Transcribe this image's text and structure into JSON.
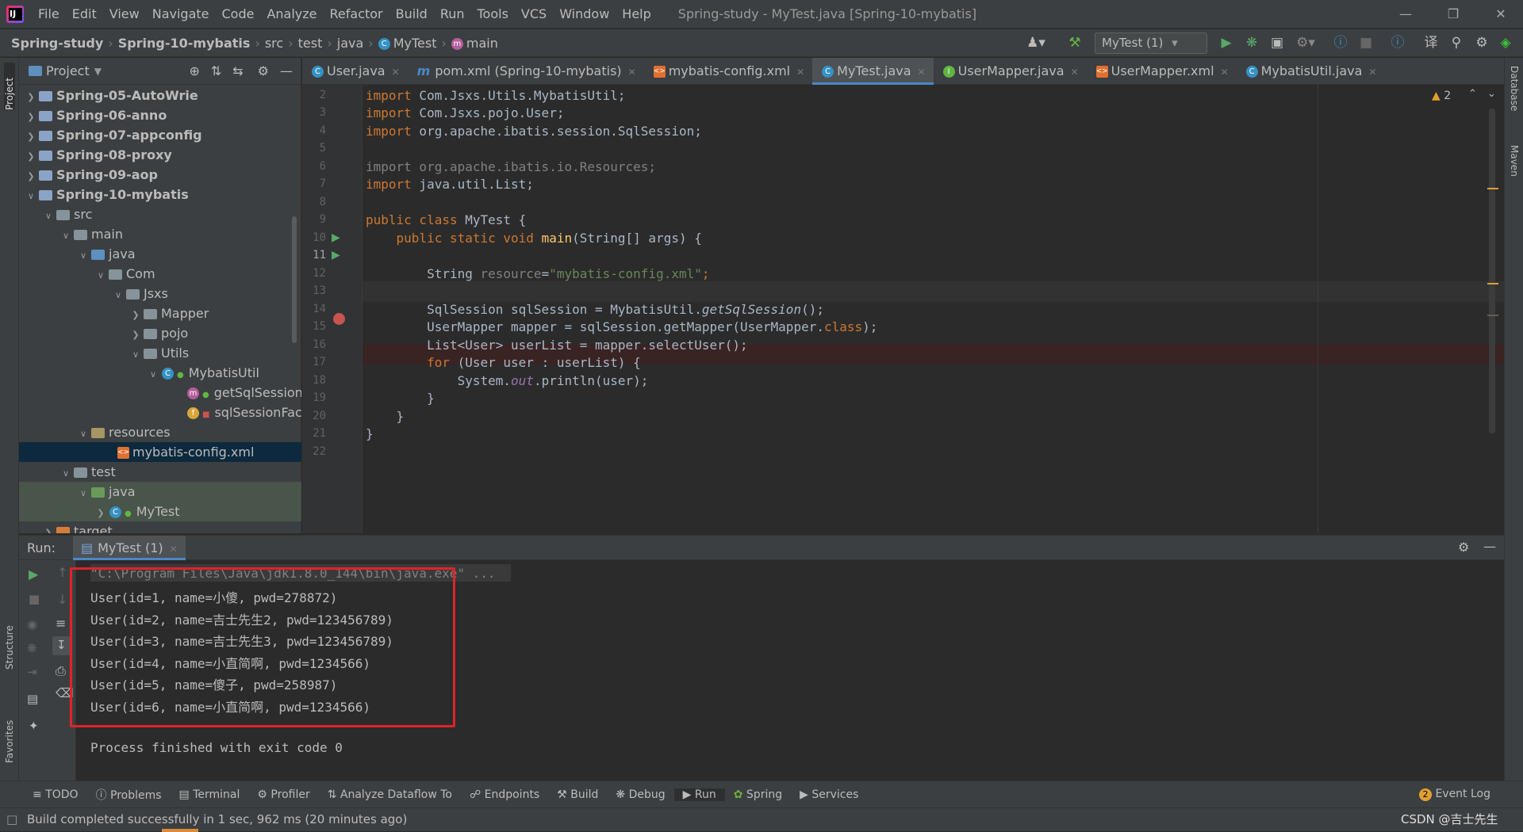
{
  "menu": [
    "File",
    "Edit",
    "View",
    "Navigate",
    "Code",
    "Analyze",
    "Refactor",
    "Build",
    "Run",
    "Tools",
    "VCS",
    "Window",
    "Help"
  ],
  "window_title": "Spring-study - MyTest.java [Spring-10-mybatis]",
  "breadcrumb": {
    "project": "Spring-study",
    "module": "Spring-10-mybatis",
    "src": "src",
    "test": "test",
    "java": "java",
    "class": "MyTest",
    "method": "main"
  },
  "run_config": "MyTest (1)",
  "project_panel": {
    "title": "Project"
  },
  "tree": [
    {
      "label": "Spring-05-AutoWrie",
      "bold": true
    },
    {
      "label": "Spring-06-anno",
      "bold": true
    },
    {
      "label": "Spring-07-appconfig",
      "bold": true
    },
    {
      "label": "Spring-08-proxy",
      "bold": true
    },
    {
      "label": "Spring-09-aop",
      "bold": true
    },
    {
      "label": "Spring-10-mybatis",
      "bold": true
    },
    {
      "label": "src"
    },
    {
      "label": "main"
    },
    {
      "label": "java"
    },
    {
      "label": "Com"
    },
    {
      "label": "Jsxs"
    },
    {
      "label": "Mapper"
    },
    {
      "label": "pojo"
    },
    {
      "label": "Utils"
    },
    {
      "label": "MybatisUtil"
    },
    {
      "label": "getSqlSession"
    },
    {
      "label": "sqlSessionFactory"
    },
    {
      "label": "resources"
    },
    {
      "label": "mybatis-config.xml"
    },
    {
      "label": "test"
    },
    {
      "label": "java"
    },
    {
      "label": "MyTest"
    },
    {
      "label": "target"
    }
  ],
  "tabs": [
    "User.java",
    "pom.xml (Spring-10-mybatis)",
    "mybatis-config.xml",
    "MyTest.java",
    "UserMapper.java",
    "UserMapper.xml",
    "MybatisUtil.java"
  ],
  "warnings": "2",
  "line_numbers": [
    "2",
    "3",
    "4",
    "5",
    "6",
    "7",
    "8",
    "9",
    "10",
    "11",
    "12",
    "13",
    "14",
    "15",
    "16",
    "17",
    "18",
    "19",
    "20",
    "21",
    "22"
  ],
  "code": {
    "l2a": "import",
    "l2b": " Com.Jsxs.Utils.MybatisUtil;",
    "l3a": "import",
    "l3b": " Com.Jsxs.pojo.User;",
    "l4a": "import",
    "l4b": " org.apache.ibatis.session.SqlSession;",
    "l6": "import org.apache.ibatis.io.Resources;",
    "l7a": "import",
    "l7b": " java.util.List;",
    "l9a": "public class",
    "l9b": " MyTest {",
    "l10a": "    public static void ",
    "l10b": "main",
    "l10c": "(String[] args) {",
    "l12a": "        String ",
    "l12b": "resource",
    "l12c": "=",
    "l12d": "\"mybatis-config.xml\"",
    "l12e": ";",
    "l14a": "        SqlSession sqlSession = MybatisUtil.",
    "l14b": "getSqlSession",
    "l14c": "();",
    "l15a": "        UserMapper mapper = sqlSession.getMapper(UserMapper.",
    "l15b": "class",
    "l15c": ");",
    "l16": "        List<User> userList = mapper.selectUser();",
    "l17a": "        for",
    "l17b": " (User user : userList) {",
    "l18a": "            System.",
    "l18b": "out",
    "l18c": ".println(user);",
    "l19": "        }",
    "l20": "    }",
    "l21": "}"
  },
  "run_panel": {
    "label": "Run:",
    "tab": "MyTest (1)"
  },
  "console": [
    "\"C:\\Program Files\\Java\\jdk1.8.0_144\\bin\\java.exe\" ...",
    "User(id=1, name=小傻, pwd=278872)",
    "User(id=2, name=吉士先生2, pwd=123456789)",
    "User(id=3, name=吉士先生3, pwd=123456789)",
    "User(id=4, name=小直简啊, pwd=1234566)",
    "User(id=5, name=傻子, pwd=258987)",
    "User(id=6, name=小直简啊, pwd=1234566)",
    "",
    "Process finished with exit code 0"
  ],
  "bottom_tabs": [
    "TODO",
    "Problems",
    "Terminal",
    "Profiler",
    "Analyze Dataflow To",
    "Endpoints",
    "Build",
    "Debug",
    "Run",
    "Spring",
    "Services"
  ],
  "event_log": {
    "count": "2",
    "label": "Event Log"
  },
  "status": "Build completed successfully in 1 sec, 962 ms (20 minutes ago)",
  "watermark": "CSDN @吉士先生",
  "side_labels": {
    "project": "Project",
    "structure": "Structure",
    "favorites": "Favorites",
    "database": "Database",
    "maven": "Maven"
  },
  "colors": {
    "breakpoint": "#c75450",
    "highlight_box": "#e0222a",
    "selection": "#0d293e"
  }
}
